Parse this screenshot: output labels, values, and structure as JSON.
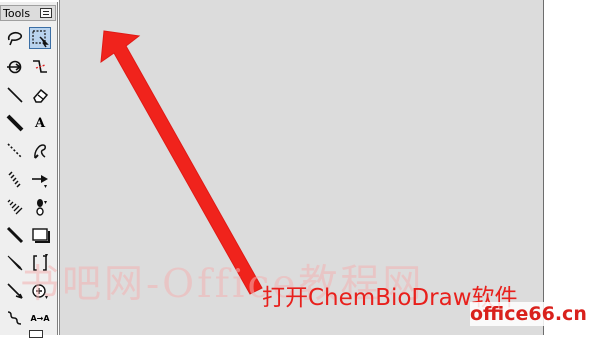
{
  "palette": {
    "title": "Tools",
    "tools": [
      {
        "name": "lasso-icon"
      },
      {
        "name": "marquee-icon",
        "selected": true
      },
      {
        "name": "structure-perspective-icon"
      },
      {
        "name": "mass-fragmentation-icon"
      },
      {
        "name": "bond-icon"
      },
      {
        "name": "eraser-icon"
      },
      {
        "name": "bold-bond-icon"
      },
      {
        "name": "text-tool-icon",
        "label": "A"
      },
      {
        "name": "dashed-bond-icon"
      },
      {
        "name": "pen-icon"
      },
      {
        "name": "hashed-bond-icon"
      },
      {
        "name": "arrow-icon"
      },
      {
        "name": "hashed-wedge-icon"
      },
      {
        "name": "orbital-icon"
      },
      {
        "name": "wedge-bond-icon"
      },
      {
        "name": "rectangle-icon"
      },
      {
        "name": "wedge-bond-filled-icon"
      },
      {
        "name": "brackets-icon"
      },
      {
        "name": "chain-icon"
      },
      {
        "name": "charge-icon"
      },
      {
        "name": "wavy-bond-icon"
      },
      {
        "name": "reaction-atom-mapping-icon",
        "label": "A→A"
      }
    ]
  },
  "annotation": {
    "caption": "打开ChemBioDraw软件",
    "arrow_color": "#f0231c"
  },
  "watermark": {
    "text": "书吧网-Office教程网",
    "site": "office66.cn"
  }
}
